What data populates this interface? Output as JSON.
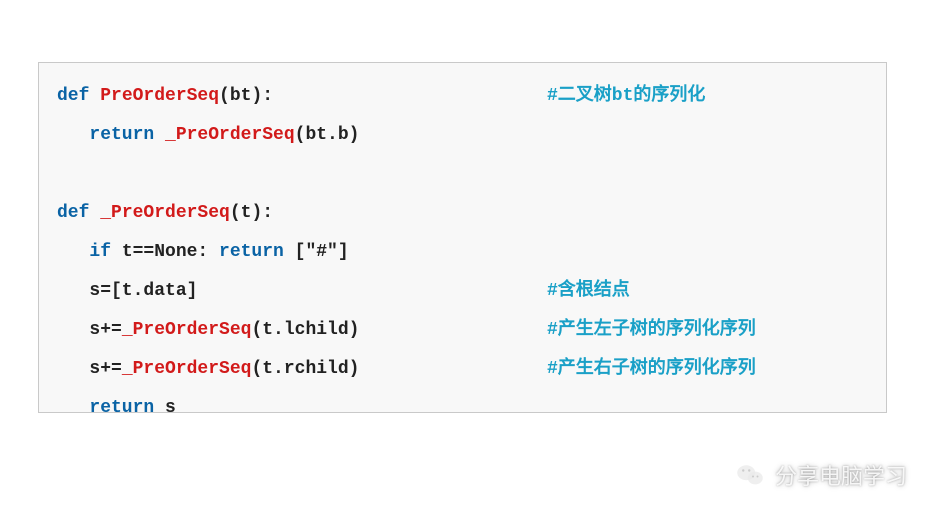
{
  "code": {
    "lines": [
      {
        "indent": 0,
        "tokens": [
          {
            "cls": "kw",
            "t": "def "
          },
          {
            "cls": "fn-red",
            "t": "PreOrderSeq"
          },
          {
            "cls": "pl",
            "t": "(bt):"
          }
        ],
        "comment": "#二叉树bt的序列化"
      },
      {
        "indent": 1,
        "tokens": [
          {
            "cls": "kw",
            "t": "return "
          },
          {
            "cls": "fn-red",
            "t": "_PreOrderSeq"
          },
          {
            "cls": "pl",
            "t": "(bt.b)"
          }
        ],
        "comment": ""
      },
      {
        "indent": 0,
        "tokens": [
          {
            "cls": "pl",
            "t": " "
          }
        ],
        "comment": ""
      },
      {
        "indent": 0,
        "tokens": [
          {
            "cls": "kw",
            "t": "def "
          },
          {
            "cls": "fn-red",
            "t": "_PreOrderSeq"
          },
          {
            "cls": "pl",
            "t": "(t):"
          }
        ],
        "comment": ""
      },
      {
        "indent": 1,
        "tokens": [
          {
            "cls": "kw",
            "t": "if "
          },
          {
            "cls": "pl",
            "t": "t==None: "
          },
          {
            "cls": "kw",
            "t": "return "
          },
          {
            "cls": "pl",
            "t": "[\"#\"]"
          }
        ],
        "comment": ""
      },
      {
        "indent": 1,
        "tokens": [
          {
            "cls": "pl",
            "t": "s=[t.data]"
          }
        ],
        "comment": "#含根结点"
      },
      {
        "indent": 1,
        "tokens": [
          {
            "cls": "pl",
            "t": "s+="
          },
          {
            "cls": "fn-red",
            "t": "_PreOrderSeq"
          },
          {
            "cls": "pl",
            "t": "(t.lchild)"
          }
        ],
        "comment": "#产生左子树的序列化序列"
      },
      {
        "indent": 1,
        "tokens": [
          {
            "cls": "pl",
            "t": "s+="
          },
          {
            "cls": "fn-red",
            "t": "_PreOrderSeq"
          },
          {
            "cls": "pl",
            "t": "(t.rchild)"
          }
        ],
        "comment": "#产生右子树的序列化序列"
      },
      {
        "indent": 1,
        "tokens": [
          {
            "cls": "kw",
            "t": "return "
          },
          {
            "cls": "pl",
            "t": "s"
          }
        ],
        "comment": ""
      }
    ],
    "indent_unit": "   "
  },
  "watermark": {
    "text": "分享电脑学习",
    "icon": "wechat-icon"
  }
}
